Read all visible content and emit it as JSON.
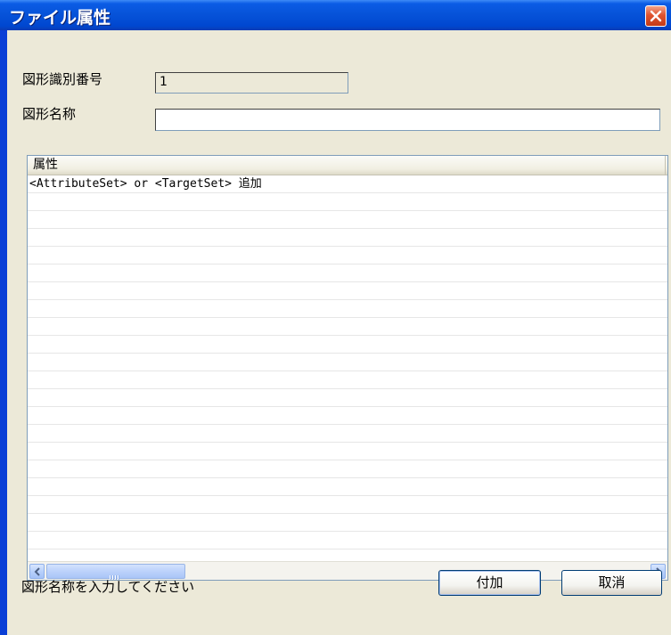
{
  "window": {
    "title": "ファイル属性"
  },
  "form": {
    "id_label": "図形識別番号",
    "id_value": "1",
    "name_label": "図形名称",
    "name_value": ""
  },
  "list": {
    "column_header": "属性",
    "rows": [
      "<AttributeSet> or <TargetSet> 追加"
    ]
  },
  "buttons": {
    "add_label": "付加",
    "cancel_label": "取消"
  },
  "status": {
    "message": "図形名称を入力してください"
  },
  "icons": {
    "close": "close-icon",
    "scroll_left": "arrow-left-icon",
    "scroll_right": "arrow-right-icon"
  },
  "colors": {
    "title_bar": "#0652d8",
    "dialog_bg": "#ece9d8",
    "close_button": "#e0532f"
  }
}
